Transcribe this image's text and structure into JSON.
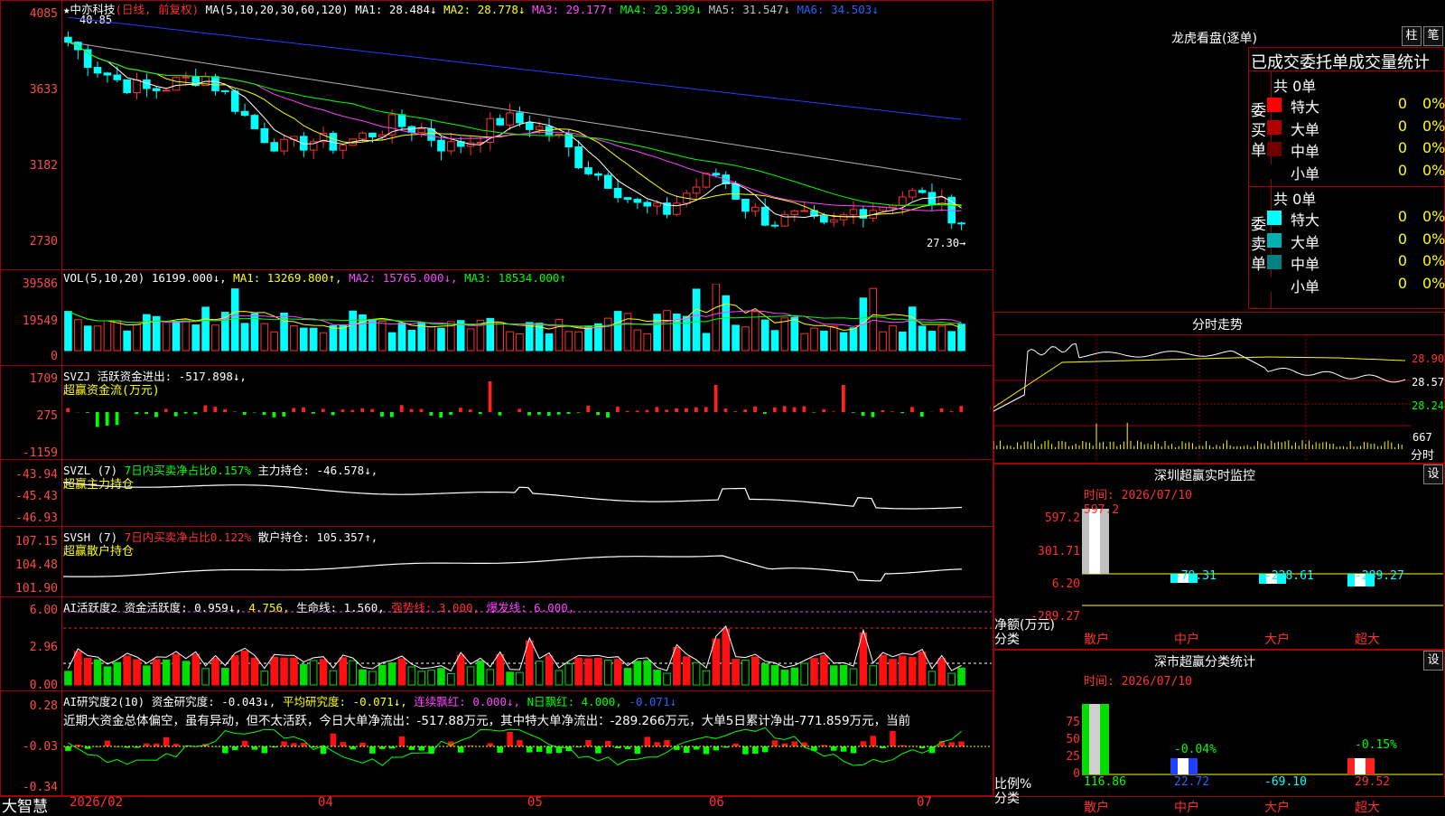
{
  "main": {
    "title": "★中亦科技",
    "mode": "(日线, 前复权)",
    "ma_label": "MA(5,10,20,30,60,120)",
    "ma": [
      {
        "text": "MA1: 28.484↓",
        "color": "#ffffff"
      },
      {
        "text": "MA2: 28.778↓",
        "color": "#ffff00"
      },
      {
        "text": "MA3: 29.177↑",
        "color": "#ff44ff"
      },
      {
        "text": "MA4: 29.399↓",
        "color": "#00ff00"
      },
      {
        "text": "MA5: 31.547↓",
        "color": "#c0c0c0"
      },
      {
        "text": "MA6: 34.503↓",
        "color": "#3060ff"
      }
    ],
    "yticks": [
      "4085",
      "3633",
      "3182",
      "2730"
    ],
    "high_label": "40.85",
    "low_label": "27.30→"
  },
  "vol": {
    "header": "VOL(5,10,20)",
    "value": "16199.000↓,",
    "ma1": "MA1: 13269.800↑,",
    "ma2": "MA2: 15765.000↓,",
    "ma3": "MA3: 18534.000↑",
    "yticks": [
      "39586",
      "19549",
      "0"
    ]
  },
  "svzj": {
    "header": "SVZJ  活跃资金进出: -517.898↓,",
    "sub": "超赢资金流(万元)",
    "yticks": [
      "1709",
      "275",
      "-1159"
    ]
  },
  "svzl": {
    "header_a": "SVZL (7)",
    "header_b": "7日内买卖净占比0.157%",
    "header_c": "主力持仓: -46.578↓,",
    "sub": "超赢主力持仓",
    "yticks": [
      "-43.94",
      "-45.43",
      "-46.93"
    ]
  },
  "svsh": {
    "header_a": "SVSH (7)",
    "header_b": "7日内买卖净占比0.122%",
    "header_c": "散户持仓: 105.357↑,",
    "sub": "超赢散户持仓",
    "yticks": [
      "107.15",
      "104.48",
      "101.90"
    ]
  },
  "ai1": {
    "header_a": "AI活跃度2 资金活跃度: 0.959↓,",
    "header_b": "4.756,",
    "header_c": "生命线: 1.560,",
    "header_d": "强势线: 3.000,",
    "header_e": "爆发线: 6.000,",
    "yticks": [
      "6.00",
      "2.96",
      "0.00"
    ]
  },
  "ai2": {
    "header_a": "AI研究度2(10) 资金研究度: -0.043↓,",
    "header_b": "平均研究度: -0.071↓,",
    "header_c": "连续飘红: 0.000↓,",
    "header_d": "N日飘红: 4.000,",
    "header_e": "-0.071↓",
    "comment": "近期大资金总体偏空，虽有异动，但不太活跃，今日大单净流出：-517.88万元，其中特大单净流出：-289.266万元，大单5日累计净出-771.859万元，当前",
    "yticks": [
      "0.28",
      "-0.03",
      "-0.34"
    ]
  },
  "xaxis": {
    "brand": "大智慧",
    "labels": [
      "2026/02",
      "04",
      "05",
      "06",
      "07"
    ]
  },
  "right": {
    "longhu": {
      "title": "龙虎看盘(逐单)",
      "btn1": "柱",
      "btn2": "笔"
    },
    "order_stats": {
      "title": "已成交委托单成交量统计",
      "buy_label": "委买单",
      "buy_total": "共 0单",
      "sell_label": "委卖单",
      "sell_total": "共 0单",
      "buy_rows": [
        {
          "label": "特大",
          "count": "0",
          "pct": "0%",
          "color": "#ff0000"
        },
        {
          "label": "大单",
          "count": "0",
          "pct": "0%",
          "color": "#b00000"
        },
        {
          "label": "中单",
          "count": "0",
          "pct": "0%",
          "color": "#700000"
        },
        {
          "label": "小单",
          "count": "0",
          "pct": "0%",
          "color": "#000000"
        }
      ],
      "sell_rows": [
        {
          "label": "特大",
          "count": "0",
          "pct": "0%",
          "color": "#00ffff"
        },
        {
          "label": "大单",
          "count": "0",
          "pct": "0%",
          "color": "#00b0b0"
        },
        {
          "label": "中单",
          "count": "0",
          "pct": "0%",
          "color": "#008080"
        },
        {
          "label": "小单",
          "count": "0",
          "pct": "0%",
          "color": "#000000"
        }
      ]
    },
    "intraday": {
      "title": "分时走势",
      "yticks": [
        "28.90",
        "28.57",
        "28.24"
      ],
      "vol_tick": "667",
      "vol_label": "分时"
    },
    "sz_monitor": {
      "title": "深圳超赢实时监控",
      "btn": "设",
      "time": "时间: 2026/07/10",
      "yticks": [
        "597.2",
        "301.71",
        "6.20",
        "-289.27"
      ],
      "net_label": "净额(万元)",
      "class_label": "分类",
      "categories": [
        "散户",
        "中户",
        "大户",
        "超大"
      ],
      "values": [
        "597.2",
        "-79.31",
        "-228.61",
        "-289.27"
      ],
      "chart_data": {
        "type": "bar",
        "categories": [
          "散户",
          "中户",
          "大户",
          "超大"
        ],
        "values": [
          597.2,
          -79.31,
          -228.61,
          -289.27
        ],
        "ylim": [
          -289.27,
          597.2
        ]
      }
    },
    "sz_class": {
      "title": "深市超赢分类统计",
      "btn": "设",
      "time": "时间: 2026/07/10",
      "yticks": [
        "75",
        "50",
        "25",
        "0"
      ],
      "ratio_label": "比例%",
      "class_label": "分类",
      "categories": [
        "散户",
        "中户",
        "大户",
        "超大"
      ],
      "values": [
        "116.86",
        "22.72",
        "-69.10",
        "29.52"
      ],
      "top_labels": [
        "-0.04%",
        "-0.15%"
      ],
      "chart_data": {
        "type": "bar",
        "categories": [
          "散户",
          "中户",
          "大户",
          "超大"
        ],
        "values": [
          116.86,
          22.72,
          -69.1,
          29.52
        ],
        "ylim": [
          0,
          75
        ]
      }
    }
  }
}
